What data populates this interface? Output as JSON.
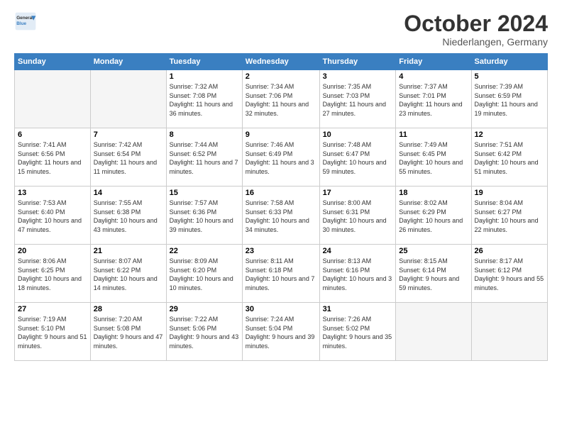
{
  "header": {
    "logo_general": "General",
    "logo_blue": "Blue",
    "title": "October 2024",
    "location": "Niederlangen, Germany"
  },
  "calendar": {
    "days_of_week": [
      "Sunday",
      "Monday",
      "Tuesday",
      "Wednesday",
      "Thursday",
      "Friday",
      "Saturday"
    ],
    "weeks": [
      [
        {
          "day": "",
          "info": ""
        },
        {
          "day": "",
          "info": ""
        },
        {
          "day": "1",
          "info": "Sunrise: 7:32 AM\nSunset: 7:08 PM\nDaylight: 11 hours and 36 minutes."
        },
        {
          "day": "2",
          "info": "Sunrise: 7:34 AM\nSunset: 7:06 PM\nDaylight: 11 hours and 32 minutes."
        },
        {
          "day": "3",
          "info": "Sunrise: 7:35 AM\nSunset: 7:03 PM\nDaylight: 11 hours and 27 minutes."
        },
        {
          "day": "4",
          "info": "Sunrise: 7:37 AM\nSunset: 7:01 PM\nDaylight: 11 hours and 23 minutes."
        },
        {
          "day": "5",
          "info": "Sunrise: 7:39 AM\nSunset: 6:59 PM\nDaylight: 11 hours and 19 minutes."
        }
      ],
      [
        {
          "day": "6",
          "info": "Sunrise: 7:41 AM\nSunset: 6:56 PM\nDaylight: 11 hours and 15 minutes."
        },
        {
          "day": "7",
          "info": "Sunrise: 7:42 AM\nSunset: 6:54 PM\nDaylight: 11 hours and 11 minutes."
        },
        {
          "day": "8",
          "info": "Sunrise: 7:44 AM\nSunset: 6:52 PM\nDaylight: 11 hours and 7 minutes."
        },
        {
          "day": "9",
          "info": "Sunrise: 7:46 AM\nSunset: 6:49 PM\nDaylight: 11 hours and 3 minutes."
        },
        {
          "day": "10",
          "info": "Sunrise: 7:48 AM\nSunset: 6:47 PM\nDaylight: 10 hours and 59 minutes."
        },
        {
          "day": "11",
          "info": "Sunrise: 7:49 AM\nSunset: 6:45 PM\nDaylight: 10 hours and 55 minutes."
        },
        {
          "day": "12",
          "info": "Sunrise: 7:51 AM\nSunset: 6:42 PM\nDaylight: 10 hours and 51 minutes."
        }
      ],
      [
        {
          "day": "13",
          "info": "Sunrise: 7:53 AM\nSunset: 6:40 PM\nDaylight: 10 hours and 47 minutes."
        },
        {
          "day": "14",
          "info": "Sunrise: 7:55 AM\nSunset: 6:38 PM\nDaylight: 10 hours and 43 minutes."
        },
        {
          "day": "15",
          "info": "Sunrise: 7:57 AM\nSunset: 6:36 PM\nDaylight: 10 hours and 39 minutes."
        },
        {
          "day": "16",
          "info": "Sunrise: 7:58 AM\nSunset: 6:33 PM\nDaylight: 10 hours and 34 minutes."
        },
        {
          "day": "17",
          "info": "Sunrise: 8:00 AM\nSunset: 6:31 PM\nDaylight: 10 hours and 30 minutes."
        },
        {
          "day": "18",
          "info": "Sunrise: 8:02 AM\nSunset: 6:29 PM\nDaylight: 10 hours and 26 minutes."
        },
        {
          "day": "19",
          "info": "Sunrise: 8:04 AM\nSunset: 6:27 PM\nDaylight: 10 hours and 22 minutes."
        }
      ],
      [
        {
          "day": "20",
          "info": "Sunrise: 8:06 AM\nSunset: 6:25 PM\nDaylight: 10 hours and 18 minutes."
        },
        {
          "day": "21",
          "info": "Sunrise: 8:07 AM\nSunset: 6:22 PM\nDaylight: 10 hours and 14 minutes."
        },
        {
          "day": "22",
          "info": "Sunrise: 8:09 AM\nSunset: 6:20 PM\nDaylight: 10 hours and 10 minutes."
        },
        {
          "day": "23",
          "info": "Sunrise: 8:11 AM\nSunset: 6:18 PM\nDaylight: 10 hours and 7 minutes."
        },
        {
          "day": "24",
          "info": "Sunrise: 8:13 AM\nSunset: 6:16 PM\nDaylight: 10 hours and 3 minutes."
        },
        {
          "day": "25",
          "info": "Sunrise: 8:15 AM\nSunset: 6:14 PM\nDaylight: 9 hours and 59 minutes."
        },
        {
          "day": "26",
          "info": "Sunrise: 8:17 AM\nSunset: 6:12 PM\nDaylight: 9 hours and 55 minutes."
        }
      ],
      [
        {
          "day": "27",
          "info": "Sunrise: 7:19 AM\nSunset: 5:10 PM\nDaylight: 9 hours and 51 minutes."
        },
        {
          "day": "28",
          "info": "Sunrise: 7:20 AM\nSunset: 5:08 PM\nDaylight: 9 hours and 47 minutes."
        },
        {
          "day": "29",
          "info": "Sunrise: 7:22 AM\nSunset: 5:06 PM\nDaylight: 9 hours and 43 minutes."
        },
        {
          "day": "30",
          "info": "Sunrise: 7:24 AM\nSunset: 5:04 PM\nDaylight: 9 hours and 39 minutes."
        },
        {
          "day": "31",
          "info": "Sunrise: 7:26 AM\nSunset: 5:02 PM\nDaylight: 9 hours and 35 minutes."
        },
        {
          "day": "",
          "info": ""
        },
        {
          "day": "",
          "info": ""
        }
      ]
    ]
  }
}
